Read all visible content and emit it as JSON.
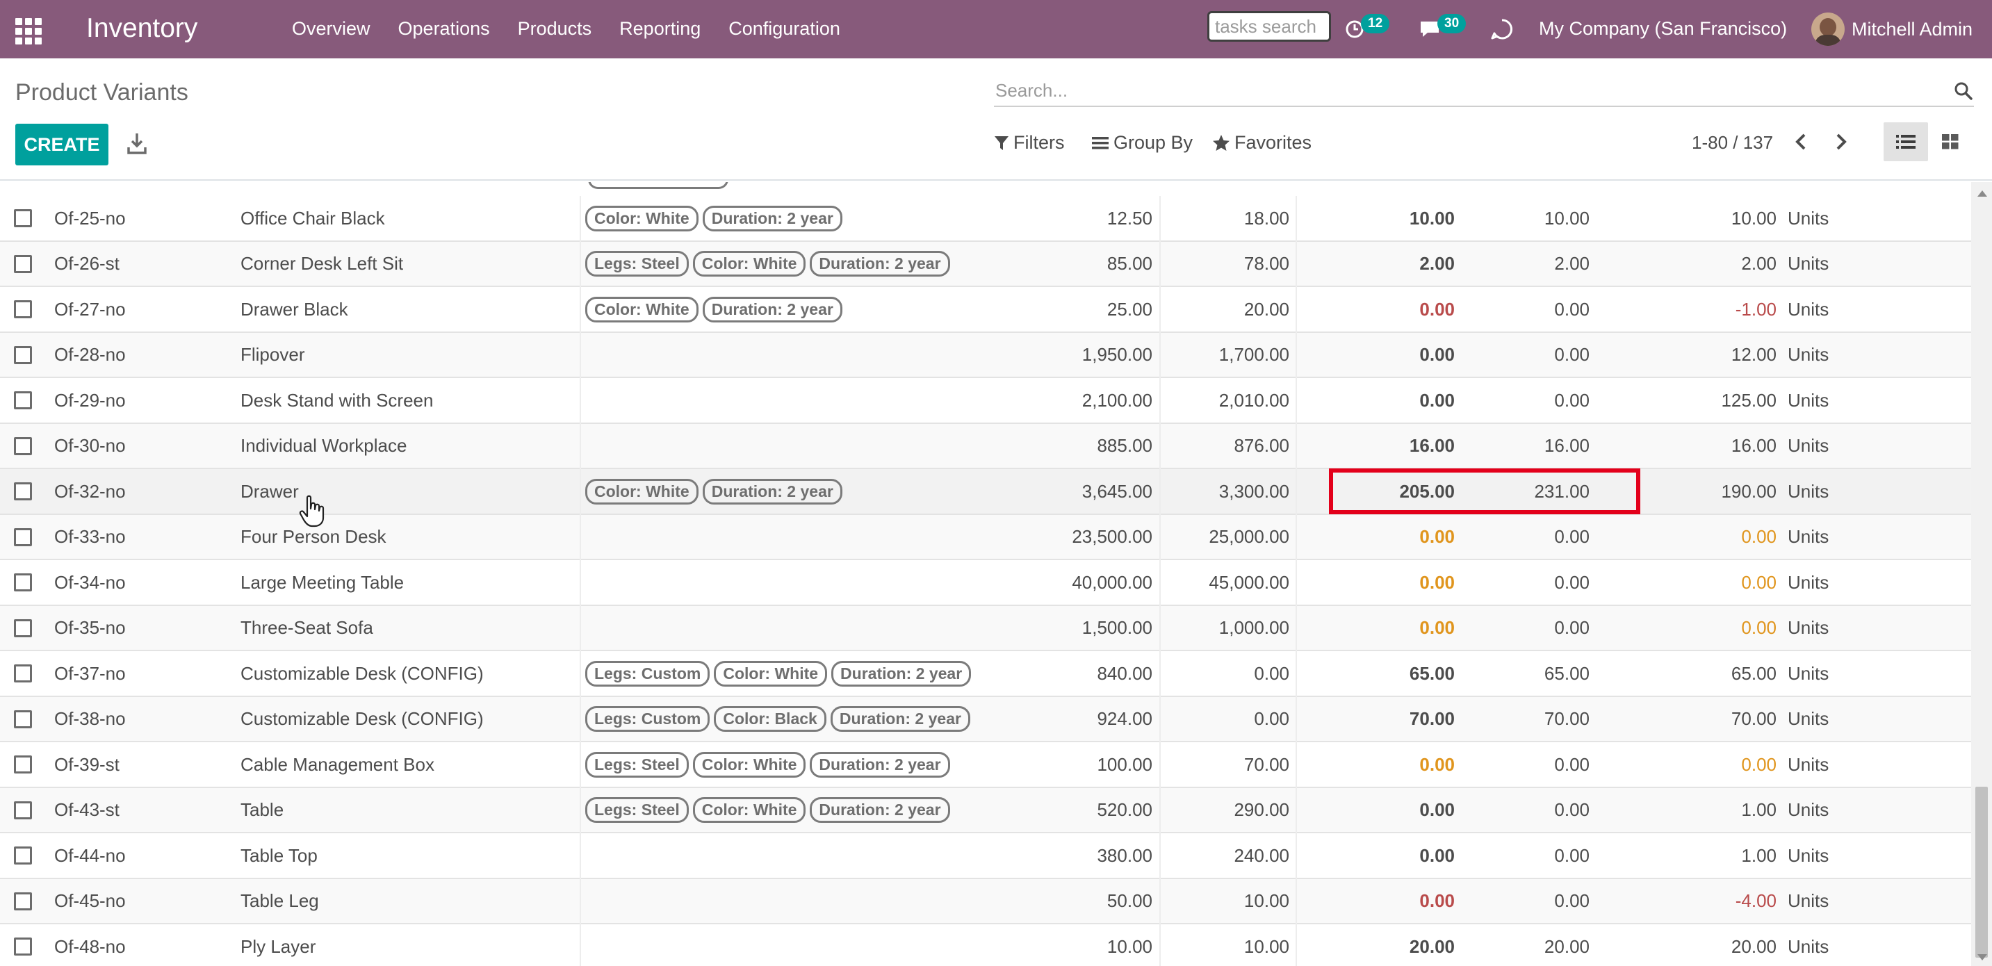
{
  "app": {
    "name": "Inventory"
  },
  "menu": [
    "Overview",
    "Operations",
    "Products",
    "Reporting",
    "Configuration"
  ],
  "systray": {
    "tasks_search_placeholder": "tasks search",
    "activities_count": "12",
    "messages_count": "30",
    "company": "My Company (San Francisco)",
    "user": "Mitchell Admin"
  },
  "control_panel": {
    "title": "Product Variants",
    "search_placeholder": "Search...",
    "create_label": "CREATE",
    "filters_label": "Filters",
    "groupby_label": "Group By",
    "favorites_label": "Favorites",
    "pager": "1-80 / 137"
  },
  "colors": {
    "navbar": "#875a7b",
    "accent": "#00a09d",
    "negative": "#b94b4b",
    "warning": "#e0951d",
    "highlight": "#e3001b"
  },
  "rows": [
    {
      "ref": "Of-25-no",
      "name": "Office Chair Black",
      "tags": [
        "Color: White",
        "Duration: 2 year"
      ],
      "price": "12.50",
      "cost": "18.00",
      "onhand": "10.00",
      "reserved": "10.00",
      "forecast": "10.00",
      "uom": "Units"
    },
    {
      "ref": "Of-26-st",
      "name": "Corner Desk Left Sit",
      "tags": [
        "Legs: Steel",
        "Color: White",
        "Duration: 2 year"
      ],
      "price": "85.00",
      "cost": "78.00",
      "onhand": "2.00",
      "reserved": "2.00",
      "forecast": "2.00",
      "uom": "Units"
    },
    {
      "ref": "Of-27-no",
      "name": "Drawer Black",
      "tags": [
        "Color: White",
        "Duration: 2 year"
      ],
      "price": "25.00",
      "cost": "20.00",
      "onhand": "0.00",
      "reserved": "0.00",
      "forecast": "-1.00",
      "uom": "Units",
      "onhand_status": "red",
      "forecast_status": "red"
    },
    {
      "ref": "Of-28-no",
      "name": "Flipover",
      "tags": [],
      "price": "1,950.00",
      "cost": "1,700.00",
      "onhand": "0.00",
      "reserved": "0.00",
      "forecast": "12.00",
      "uom": "Units"
    },
    {
      "ref": "Of-29-no",
      "name": "Desk Stand with Screen",
      "tags": [],
      "price": "2,100.00",
      "cost": "2,010.00",
      "onhand": "0.00",
      "reserved": "0.00",
      "forecast": "125.00",
      "uom": "Units"
    },
    {
      "ref": "Of-30-no",
      "name": "Individual Workplace",
      "tags": [],
      "price": "885.00",
      "cost": "876.00",
      "onhand": "16.00",
      "reserved": "16.00",
      "forecast": "16.00",
      "uom": "Units"
    },
    {
      "ref": "Of-32-no",
      "name": "Drawer",
      "tags": [
        "Color: White",
        "Duration: 2 year"
      ],
      "price": "3,645.00",
      "cost": "3,300.00",
      "onhand": "205.00",
      "reserved": "231.00",
      "forecast": "190.00",
      "uom": "Units"
    },
    {
      "ref": "Of-33-no",
      "name": "Four Person Desk",
      "tags": [],
      "price": "23,500.00",
      "cost": "25,000.00",
      "onhand": "0.00",
      "reserved": "0.00",
      "forecast": "0.00",
      "uom": "Units",
      "onhand_status": "orange",
      "forecast_status": "orange"
    },
    {
      "ref": "Of-34-no",
      "name": "Large Meeting Table",
      "tags": [],
      "price": "40,000.00",
      "cost": "45,000.00",
      "onhand": "0.00",
      "reserved": "0.00",
      "forecast": "0.00",
      "uom": "Units",
      "onhand_status": "orange",
      "forecast_status": "orange"
    },
    {
      "ref": "Of-35-no",
      "name": "Three-Seat Sofa",
      "tags": [],
      "price": "1,500.00",
      "cost": "1,000.00",
      "onhand": "0.00",
      "reserved": "0.00",
      "forecast": "0.00",
      "uom": "Units",
      "onhand_status": "orange",
      "forecast_status": "orange"
    },
    {
      "ref": "Of-37-no",
      "name": "Customizable Desk (CONFIG)",
      "tags": [
        "Legs: Custom",
        "Color: White",
        "Duration: 2 year"
      ],
      "price": "840.00",
      "cost": "0.00",
      "onhand": "65.00",
      "reserved": "65.00",
      "forecast": "65.00",
      "uom": "Units"
    },
    {
      "ref": "Of-38-no",
      "name": "Customizable Desk (CONFIG)",
      "tags": [
        "Legs: Custom",
        "Color: Black",
        "Duration: 2 year"
      ],
      "price": "924.00",
      "cost": "0.00",
      "onhand": "70.00",
      "reserved": "70.00",
      "forecast": "70.00",
      "uom": "Units"
    },
    {
      "ref": "Of-39-st",
      "name": "Cable Management Box",
      "tags": [
        "Legs: Steel",
        "Color: White",
        "Duration: 2 year"
      ],
      "price": "100.00",
      "cost": "70.00",
      "onhand": "0.00",
      "reserved": "0.00",
      "forecast": "0.00",
      "uom": "Units",
      "onhand_status": "orange",
      "forecast_status": "orange"
    },
    {
      "ref": "Of-43-st",
      "name": "Table",
      "tags": [
        "Legs: Steel",
        "Color: White",
        "Duration: 2 year"
      ],
      "price": "520.00",
      "cost": "290.00",
      "onhand": "0.00",
      "reserved": "0.00",
      "forecast": "1.00",
      "uom": "Units"
    },
    {
      "ref": "Of-44-no",
      "name": "Table Top",
      "tags": [],
      "price": "380.00",
      "cost": "240.00",
      "onhand": "0.00",
      "reserved": "0.00",
      "forecast": "1.00",
      "uom": "Units"
    },
    {
      "ref": "Of-45-no",
      "name": "Table Leg",
      "tags": [],
      "price": "50.00",
      "cost": "10.00",
      "onhand": "0.00",
      "reserved": "0.00",
      "forecast": "-4.00",
      "uom": "Units",
      "onhand_status": "red",
      "forecast_status": "red"
    },
    {
      "ref": "Of-48-no",
      "name": "Ply Layer",
      "tags": [],
      "price": "10.00",
      "cost": "10.00",
      "onhand": "20.00",
      "reserved": "20.00",
      "forecast": "20.00",
      "uom": "Units"
    }
  ]
}
